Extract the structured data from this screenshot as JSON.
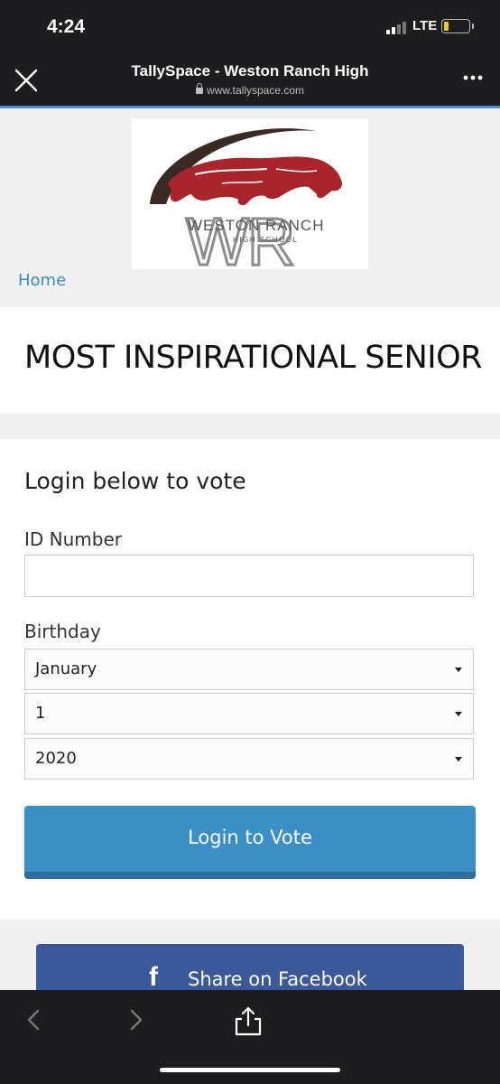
{
  "status": {
    "time": "4:24",
    "network": "LTE"
  },
  "browser": {
    "title": "TallySpace - Weston Ranch High",
    "url": "www.tallyspace.com"
  },
  "header": {
    "logo_line1": "WESTON RANCH",
    "logo_line2": "HIGH SCHOOL",
    "logo_mark": "WR",
    "home_link": "Home"
  },
  "page": {
    "title": "MOST INSPIRATIONAL SENIOR"
  },
  "login": {
    "heading": "Login below to vote",
    "id_label": "ID Number",
    "id_value": "",
    "birthday_label": "Birthday",
    "month": "January",
    "day": "1",
    "year": "2020",
    "submit_label": "Login to Vote"
  },
  "share": {
    "facebook_label": "Share on Facebook",
    "facebook_icon": "f"
  },
  "colors": {
    "accent": "#3b8fc7",
    "facebook": "#3b5998",
    "link": "#3c8dc5",
    "panther": "#a8262b"
  },
  "icons": [
    "close-icon",
    "more-icon",
    "lock-icon",
    "caret-down-icon",
    "facebook-icon",
    "back-icon",
    "forward-icon",
    "share-icon"
  ]
}
